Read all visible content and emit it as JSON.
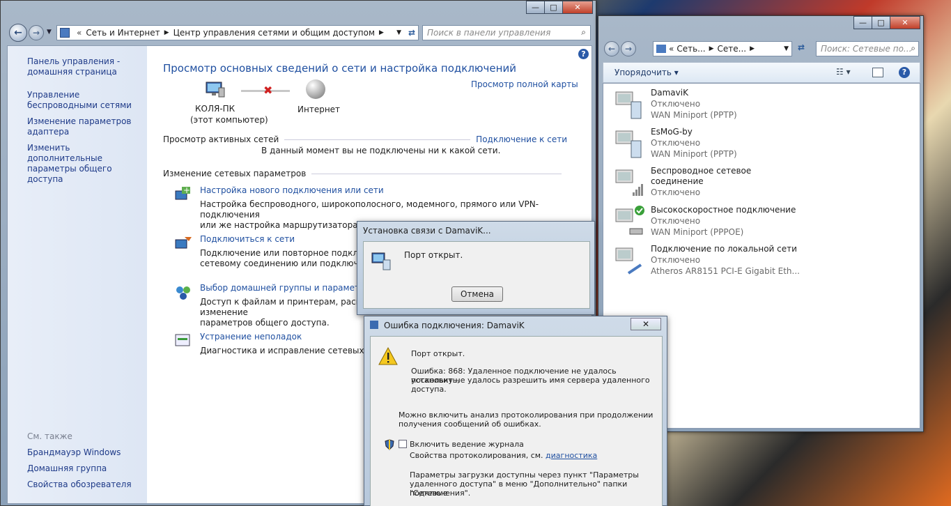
{
  "main": {
    "breadcrumb": [
      "Сеть и Интернет",
      "Центр управления сетями и общим доступом"
    ],
    "search_placeholder": "Поиск в панели управления",
    "left": {
      "home": "Панель управления - домашняя страница",
      "links": [
        "Управление беспроводными сетями",
        "Изменение параметров адаптера",
        "Изменить дополнительные параметры общего доступа"
      ],
      "see_also": "См. также",
      "see_links": [
        "Брандмауэр Windows",
        "Домашняя группа",
        "Свойства обозревателя"
      ]
    },
    "title": "Просмотр основных сведений о сети и настройка подключений",
    "full_map": "Просмотр полной карты",
    "pc_name": "КОЛЯ-ПК",
    "pc_sub": "(этот компьютер)",
    "internet": "Интернет",
    "active_header": "Просмотр активных сетей",
    "connect_link": "Подключение к сети",
    "not_connected": "В данный момент вы не подключены ни к какой сети.",
    "change_header": "Изменение сетевых параметров",
    "tasks": [
      {
        "title": "Настройка нового подключения или сети",
        "desc1": "Настройка беспроводного, широкополосного, модемного, прямого или VPN-подключения",
        "desc2": "или же настройка маршрутизатора или точки доступа."
      },
      {
        "title": "Подключиться к сети",
        "desc1": "Подключение или повторное подключение к беспроводному, проводному, модемному",
        "desc2": "сетевому соединению или подключению к VPN."
      },
      {
        "title": "Выбор домашней группы и параметров общего доступа",
        "desc1": "Доступ к файлам и принтерам, расположенным на других сетевых компьютерах, или изменение",
        "desc2": "параметров общего доступа."
      },
      {
        "title": "Устранение неполадок",
        "desc1": "Диагностика и исправление сетевых проблем или получение сведений об исправлении.",
        "desc2": ""
      }
    ]
  },
  "net": {
    "breadcrumb": [
      "Сеть...",
      "Сете..."
    ],
    "search_placeholder": "Поиск: Сетевые по...",
    "organize": "Упорядочить",
    "items": [
      {
        "name": "DamaviK",
        "name2": "",
        "status": "Отключено",
        "device": "WAN Miniport (PPTP)"
      },
      {
        "name": "EsMoG-by",
        "name2": "",
        "status": "Отключено",
        "device": "WAN Miniport (PPTP)"
      },
      {
        "name": "Беспроводное сетевое",
        "name2": "соединение",
        "status": "Отключено",
        "device": ""
      },
      {
        "name": "Высокоскоростное подключение",
        "name2": "",
        "status": "Отключено",
        "device": "WAN Miniport (PPPOE)"
      },
      {
        "name": "Подключение по локальной сети",
        "name2": "",
        "status": "Отключено",
        "device": "Atheros AR8151 PCI-E Gigabit Eth..."
      }
    ]
  },
  "dialog1": {
    "title": "Установка связи с DamaviK...",
    "message": "Порт открыт.",
    "cancel": "Отмена"
  },
  "dialog2": {
    "title": "Ошибка подключения: DamaviK",
    "message": "Порт открыт.",
    "error1": "Ошибка: 868: Удаленное подключение не удалось установить,",
    "error2": "поскольку не удалось разрешить имя сервера удаленного",
    "error3": "доступа.",
    "log1": "Можно включить анализ протоколирования при продолжении",
    "log2": "получения сообщений об ошибках.",
    "checkbox": "Включить ведение журнала",
    "props": "Свойства протоколирования, см.",
    "diag_link": "диагностика",
    "params1": "Параметры загрузки доступны через пункт \"Параметры",
    "params2": "удаленного доступа\" в меню \"Дополнительно\" папки \"Сетевые",
    "params3": "подключения\"."
  },
  "colors": {
    "link": "#1f4fa0",
    "title": "#1f4fa0",
    "red_x": "#d02020"
  }
}
